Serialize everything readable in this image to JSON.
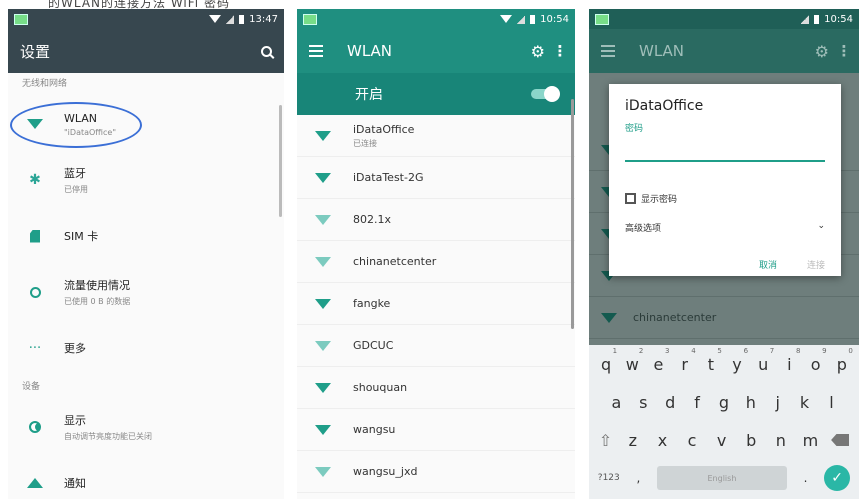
{
  "top_caption": "的WLAN的连接方法 WiFi 密码",
  "screen1": {
    "status_time": "13:47",
    "title": "设置",
    "section_wireless": "无线和网络",
    "items": [
      {
        "icon": "wifi-icon",
        "title": "WLAN",
        "subtitle": "\"iDataOffice\""
      },
      {
        "icon": "bluetooth-icon",
        "title": "蓝牙",
        "subtitle": "已停用"
      },
      {
        "icon": "sim-card-icon",
        "title": "SIM 卡",
        "subtitle": ""
      },
      {
        "icon": "data-usage-icon",
        "title": "流量使用情况",
        "subtitle": "已使用 0 B 的数据"
      },
      {
        "icon": "more-icon",
        "title": "更多",
        "subtitle": ""
      }
    ],
    "section_device": "设备",
    "device_items": [
      {
        "icon": "display-icon",
        "title": "显示",
        "subtitle": "自动调节亮度功能已关闭"
      },
      {
        "icon": "notification-icon",
        "title": "通知",
        "subtitle": ""
      }
    ]
  },
  "screen2": {
    "status_time": "10:54",
    "title": "WLAN",
    "toggle_label": "开启",
    "networks": [
      {
        "name": "iDataOffice",
        "status": "已连接"
      },
      {
        "name": "iDataTest-2G",
        "status": ""
      },
      {
        "name": "802.1x",
        "status": ""
      },
      {
        "name": "chinanetcenter",
        "status": ""
      },
      {
        "name": "fangke",
        "status": ""
      },
      {
        "name": "GDCUC",
        "status": ""
      },
      {
        "name": "shouquan",
        "status": ""
      },
      {
        "name": "wangsu",
        "status": ""
      },
      {
        "name": "wangsu_jxd",
        "status": ""
      }
    ]
  },
  "screen3": {
    "status_time": "10:54",
    "title": "WLAN",
    "bg_network": "chinanetcenter",
    "dialog": {
      "title": "iDataOffice",
      "password_label": "密码",
      "show_password": "显示密码",
      "advanced": "高级选项",
      "cancel": "取消",
      "connect": "连接"
    },
    "keyboard": {
      "row1": [
        {
          "k": "q",
          "n": "1"
        },
        {
          "k": "w",
          "n": "2"
        },
        {
          "k": "e",
          "n": "3"
        },
        {
          "k": "r",
          "n": "4"
        },
        {
          "k": "t",
          "n": "5"
        },
        {
          "k": "y",
          "n": "6"
        },
        {
          "k": "u",
          "n": "7"
        },
        {
          "k": "i",
          "n": "8"
        },
        {
          "k": "o",
          "n": "9"
        },
        {
          "k": "p",
          "n": "0"
        }
      ],
      "row2": [
        "a",
        "s",
        "d",
        "f",
        "g",
        "h",
        "j",
        "k",
        "l"
      ],
      "row3": [
        "z",
        "x",
        "c",
        "v",
        "b",
        "n",
        "m"
      ],
      "mode_key": "?123",
      "comma": ",",
      "space_label": "English"
    }
  },
  "colors": {
    "teal": "#1f9e89",
    "dark_bar": "#37474f",
    "highlight_oval": "#3b6fd6"
  }
}
